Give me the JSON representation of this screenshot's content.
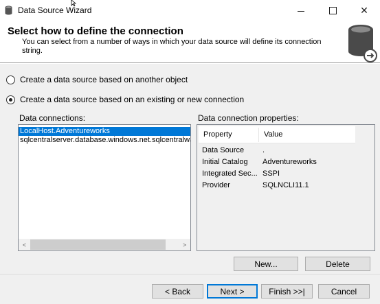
{
  "window": {
    "title": "Data Source Wizard",
    "controls": [
      "minimize",
      "maximize",
      "close"
    ],
    "close_glyph": "✕"
  },
  "header": {
    "title": "Select how to define the connection",
    "subtitle": "You can select from a number of ways in which your data source will define its connection string.",
    "icon": "database-icon"
  },
  "options": [
    {
      "label": "Create a data source based on another object",
      "checked": false
    },
    {
      "label": "Create a data source based on an existing or new connection",
      "checked": true
    }
  ],
  "connections": {
    "label": "Data connections:",
    "items": [
      {
        "text": "LocalHost.Adventureworks",
        "selected": true
      },
      {
        "text": "sqlcentralserver.database.windows.net.sqlcentralwar",
        "selected": false
      }
    ],
    "scroll_left": "<",
    "scroll_right": ">"
  },
  "properties": {
    "label": "Data connection properties:",
    "columns": [
      "Property",
      "Value"
    ],
    "rows": [
      {
        "property": "Data Source",
        "value": "."
      },
      {
        "property": "Initial Catalog",
        "value": "Adventureworks"
      },
      {
        "property": "Integrated Sec...",
        "value": "SSPI"
      },
      {
        "property": "Provider",
        "value": "SQLNCLI11.1"
      }
    ]
  },
  "buttons": {
    "new": "New...",
    "delete": "Delete",
    "back": "< Back",
    "next": "Next >",
    "finish": "Finish >>|",
    "cancel": "Cancel"
  },
  "colors": {
    "selection": "#0078d7",
    "window_bg": "#f0f0f0"
  }
}
